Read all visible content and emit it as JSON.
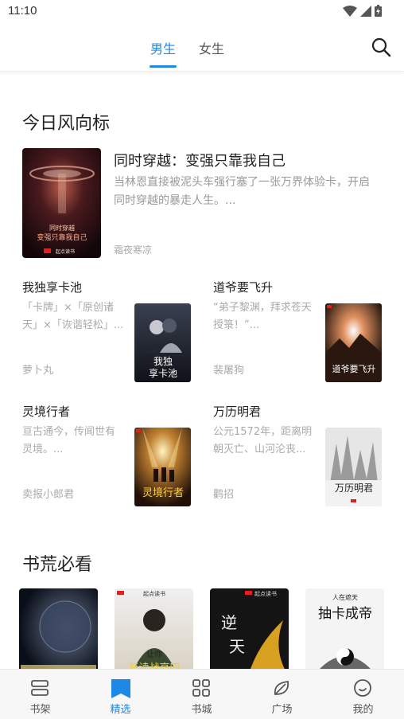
{
  "status": {
    "time": "11:10"
  },
  "header": {
    "tabs": [
      {
        "label": "男生",
        "active": true
      },
      {
        "label": "女生",
        "active": false
      }
    ],
    "accent_color": "#1e88e5"
  },
  "sections": {
    "today": {
      "title": "今日风向标",
      "featured": {
        "title": "同时穿越：变强只靠我自己",
        "description": "当林恩直接被泥头车强行塞了一张万界体验卡，开启同时穿越的暴走人生。...",
        "author": "霜夜寒凉",
        "cover_text": "同时穿越\n变强只靠我自己",
        "cover_author": "霜夜寒凉 著",
        "cover_publisher": "起点读书"
      },
      "books": [
        {
          "title": "我独享卡池",
          "description": "「卡牌」×「原创诸天」×「诙谐轻松」...",
          "author": "萝卜丸",
          "cover_text": "我独享卡池"
        },
        {
          "title": "道爷要飞升",
          "description": "“弟子黎渊，拜求苍天授箓！”...",
          "author": "裴屠狗",
          "cover_text": "道爷要飞升"
        },
        {
          "title": "灵境行者",
          "description": "亘古通今，传闻世有灵境。...",
          "author": "卖报小郎君",
          "cover_text": "灵境行者"
        },
        {
          "title": "万历明君",
          "description": "公元1572年，距离明朝灭亡、山河沦丧...",
          "author": "鹳招",
          "cover_text": "万历明君"
        }
      ]
    },
    "must_read": {
      "title": "书荒必看",
      "covers": [
        {
          "cover_text": ""
        },
        {
          "cover_text": "让你 复读战高四",
          "publisher": "起点读书"
        },
        {
          "cover_text": "逆天",
          "publisher": "起点读书"
        },
        {
          "cover_text": "抽卡成帝",
          "subtitle": "人在遮天"
        }
      ]
    }
  },
  "bottom_nav": [
    {
      "label": "书架",
      "icon": "bookshelf-icon",
      "active": false
    },
    {
      "label": "精选",
      "icon": "featured-bookmark-icon",
      "active": true
    },
    {
      "label": "书城",
      "icon": "grid-icon",
      "active": false
    },
    {
      "label": "广场",
      "icon": "leaf-icon",
      "active": false
    },
    {
      "label": "我的",
      "icon": "smile-icon",
      "active": false
    }
  ]
}
